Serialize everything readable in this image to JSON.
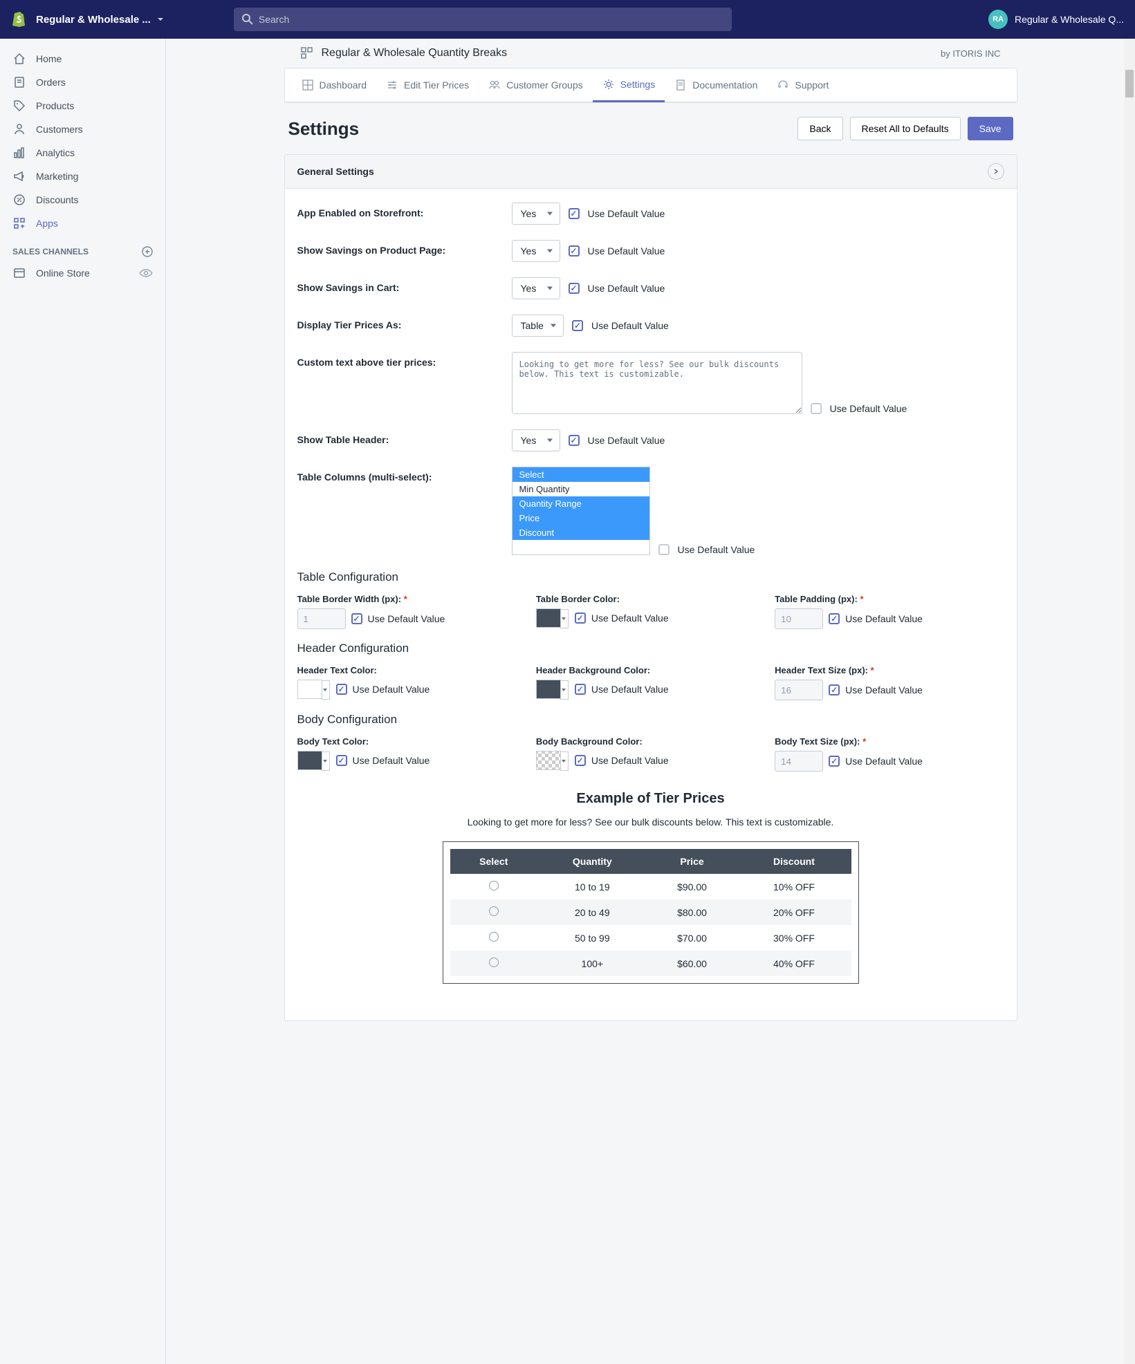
{
  "topbar": {
    "store_name": "Regular & Wholesale ...",
    "search_placeholder": "Search",
    "avatar_initials": "RA",
    "account_label": "Regular & Wholesale Q..."
  },
  "sidebar": {
    "items": [
      {
        "label": "Home"
      },
      {
        "label": "Orders"
      },
      {
        "label": "Products"
      },
      {
        "label": "Customers"
      },
      {
        "label": "Analytics"
      },
      {
        "label": "Marketing"
      },
      {
        "label": "Discounts"
      },
      {
        "label": "Apps"
      }
    ],
    "section_label": "SALES CHANNELS",
    "channels": [
      {
        "label": "Online Store"
      }
    ]
  },
  "app": {
    "title": "Regular & Wholesale Quantity Breaks",
    "byline": "by ITORIS INC"
  },
  "tabs": [
    {
      "label": "Dashboard"
    },
    {
      "label": "Edit Tier Prices"
    },
    {
      "label": "Customer Groups"
    },
    {
      "label": "Settings"
    },
    {
      "label": "Documentation"
    },
    {
      "label": "Support"
    }
  ],
  "page": {
    "title": "Settings",
    "back_btn": "Back",
    "reset_btn": "Reset All to Defaults",
    "save_btn": "Save"
  },
  "general": {
    "header": "General Settings",
    "use_default": "Use Default Value",
    "fields": {
      "app_enabled": {
        "label": "App Enabled on Storefront:",
        "value": "Yes"
      },
      "show_savings_pp": {
        "label": "Show Savings on Product Page:",
        "value": "Yes"
      },
      "show_savings_cart": {
        "label": "Show Savings in Cart:",
        "value": "Yes"
      },
      "display_as": {
        "label": "Display Tier Prices As:",
        "value": "Table"
      },
      "custom_text": {
        "label": "Custom text above tier prices:",
        "value": "Looking to get more for less? See our bulk discounts below. This text is customizable."
      },
      "show_header": {
        "label": "Show Table Header:",
        "value": "Yes"
      },
      "table_cols": {
        "label": "Table Columns (multi-select):",
        "options": [
          "Select",
          "Min Quantity",
          "Quantity Range",
          "Price",
          "Discount"
        ],
        "selected": [
          0,
          2,
          3,
          4
        ]
      }
    }
  },
  "table_cfg": {
    "heading": "Table Configuration",
    "border_width": {
      "label": "Table Border Width (px):",
      "value": "1"
    },
    "border_color": {
      "label": "Table Border Color:",
      "value": "#454f5b"
    },
    "padding": {
      "label": "Table Padding (px):",
      "value": "10"
    }
  },
  "header_cfg": {
    "heading": "Header Configuration",
    "text_color": {
      "label": "Header Text Color:",
      "value": "#ffffff"
    },
    "bg_color": {
      "label": "Header Background Color:",
      "value": "#454f5b"
    },
    "text_size": {
      "label": "Header Text Size (px):",
      "value": "16"
    }
  },
  "body_cfg": {
    "heading": "Body Configuration",
    "text_color": {
      "label": "Body Text Color:",
      "value": "#454f5b"
    },
    "bg_color": {
      "label": "Body Background Color:",
      "value": "transparent"
    },
    "text_size": {
      "label": "Body Text Size (px):",
      "value": "14"
    }
  },
  "example": {
    "title": "Example of Tier Prices",
    "desc": "Looking to get more for less? See our bulk discounts below. This text is customizable.",
    "columns": [
      "Select",
      "Quantity",
      "Price",
      "Discount"
    ],
    "rows": [
      {
        "qty": "10 to 19",
        "price": "$90.00",
        "discount": "10% OFF"
      },
      {
        "qty": "20 to 49",
        "price": "$80.00",
        "discount": "20% OFF"
      },
      {
        "qty": "50 to 99",
        "price": "$70.00",
        "discount": "30% OFF"
      },
      {
        "qty": "100+",
        "price": "$60.00",
        "discount": "40% OFF"
      }
    ]
  }
}
